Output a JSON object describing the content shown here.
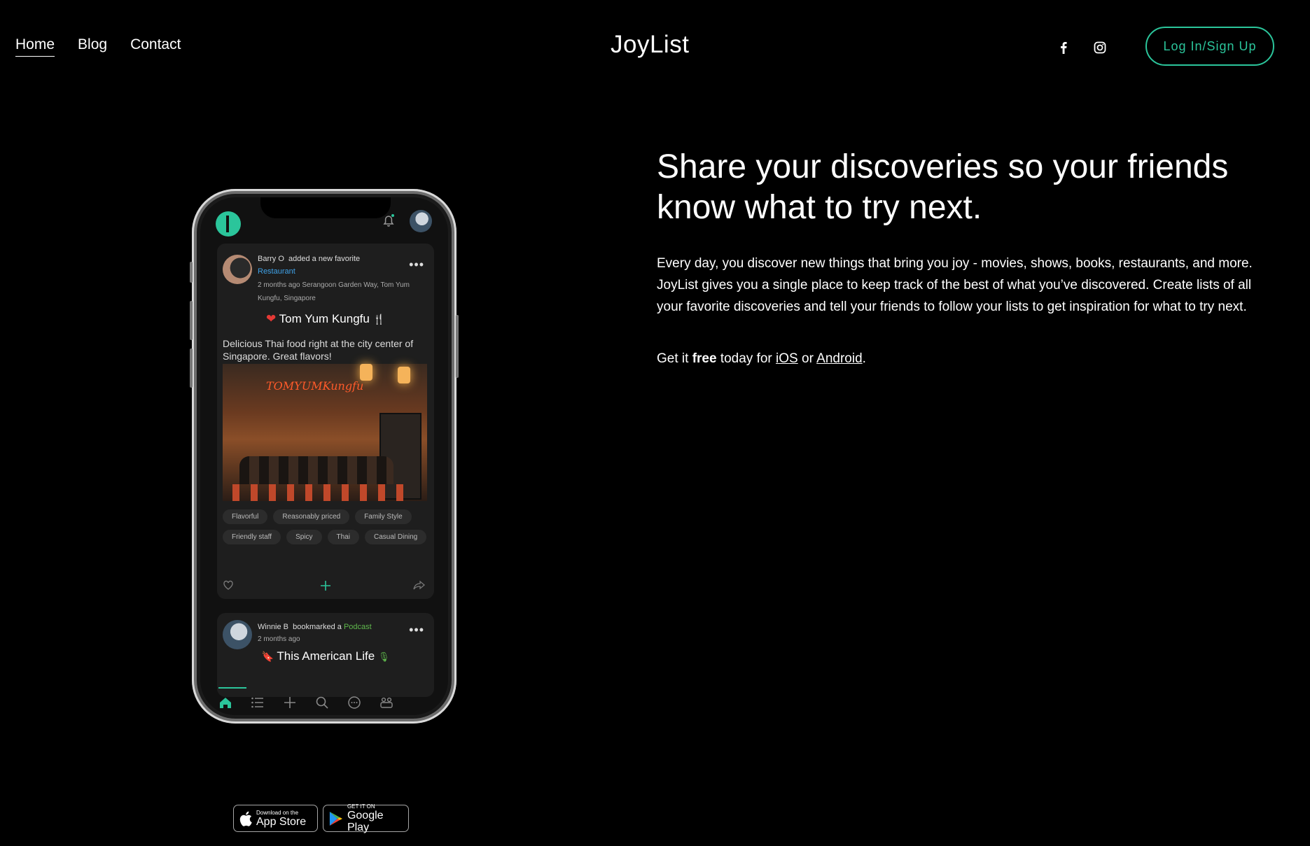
{
  "nav": {
    "items": [
      {
        "label": "Home",
        "active": true
      },
      {
        "label": "Blog",
        "active": false
      },
      {
        "label": "Contact",
        "active": false
      }
    ]
  },
  "brand": "JoyList",
  "social": [
    {
      "icon": "facebook-icon"
    },
    {
      "icon": "instagram-icon"
    }
  ],
  "login_button": "Log In/Sign Up",
  "accent_color": "#2bc59b",
  "hero": {
    "headline": "Share your discoveries so your friends know what to try next.",
    "body": "Every day, you discover new things that bring you joy - movies, shows, books, restaurants, and more. JoyList gives you a single place to keep track of the best of what you’ve discovered. Create lists of all your favorite discoveries and tell your friends to follow your lists to get inspiration for what to try next.",
    "cta_prefix": "Get it ",
    "cta_free": "free",
    "cta_middle": " today for ",
    "cta_ios": "iOS",
    "cta_or": " or ",
    "cta_android": "Android",
    "cta_end": "."
  },
  "phone": {
    "post1": {
      "user": "Barry O",
      "action": "added a new favorite",
      "category": "Restaurant",
      "time_location": "2 months ago   Serangoon Garden Way, Tom Yum Kungfu, Singapore",
      "title": "Tom Yum Kungfu",
      "description": "Delicious Thai food right at the city center of Singapore. Great flavors!",
      "photo_sign": "TOMYUMKungfu",
      "tags": [
        "Flavorful",
        "Reasonably priced",
        "Family Style",
        "Friendly staff",
        "Spicy",
        "Thai",
        "Casual Dining"
      ]
    },
    "post2": {
      "user": "Winnie B",
      "action": "bookmarked a",
      "category": "Podcast",
      "time": "2 months ago",
      "title": "This American Life"
    },
    "tabbar": [
      "home-icon",
      "list-icon",
      "add-icon",
      "search-icon",
      "chat-icon",
      "groups-icon"
    ]
  },
  "badges": {
    "apple_small": "Download on the",
    "apple_big": "App Store",
    "google_small": "GET IT ON",
    "google_big": "Google Play"
  }
}
